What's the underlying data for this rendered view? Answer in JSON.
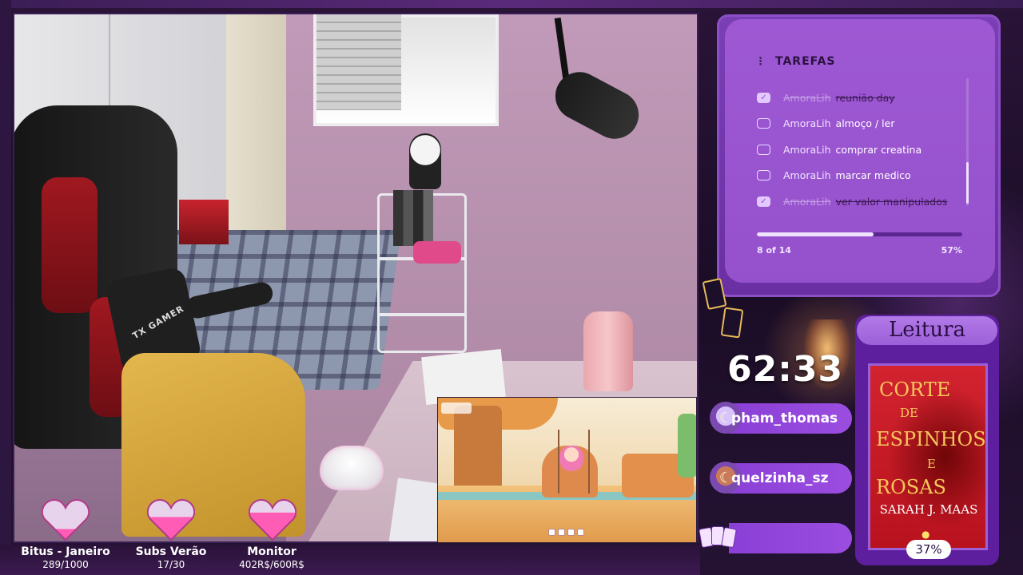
{
  "tasks": {
    "title": "TAREFAS",
    "items": [
      {
        "user": "AmoraLih",
        "text": "reunião day",
        "done": true
      },
      {
        "user": "AmoraLih",
        "text": "almoço / ler",
        "done": false
      },
      {
        "user": "AmoraLih",
        "text": "comprar creatina",
        "done": false
      },
      {
        "user": "AmoraLih",
        "text": "marcar medico",
        "done": false
      },
      {
        "user": "AmoraLih",
        "text": "ver valor manipulados",
        "done": true
      }
    ],
    "count_label": "8 of 14",
    "percent_label": "57%",
    "progress": 0.57
  },
  "timer": {
    "value": "62:33"
  },
  "chat": [
    {
      "name": "pham_thomas",
      "icon": "moon-icon"
    },
    {
      "name": "quelzinha_sz",
      "icon": "moon-icon"
    },
    {
      "name": "",
      "icon": ""
    }
  ],
  "reading": {
    "title": "Leitura",
    "book_line1": "CORTE",
    "book_line2": "DE",
    "book_line3": "ESPINHOS",
    "book_line4": "E",
    "book_line5": "ROSAS",
    "author": "SARAH J. MAAS",
    "percent": "37%"
  },
  "webcam": {
    "pillow_text": "TX GAMER"
  },
  "stats": [
    {
      "label": "Bitus - Janeiro",
      "value": "289/1000",
      "fill": 0.289
    },
    {
      "label": "Subs Verão",
      "value": "17/30",
      "fill": 0.567
    },
    {
      "label": "Monitor",
      "value": "402R$/600R$",
      "fill": 0.67
    }
  ],
  "colors": {
    "accent": "#9551cc",
    "panel": "#6a2fa3",
    "heart": "#ff5cb6"
  }
}
